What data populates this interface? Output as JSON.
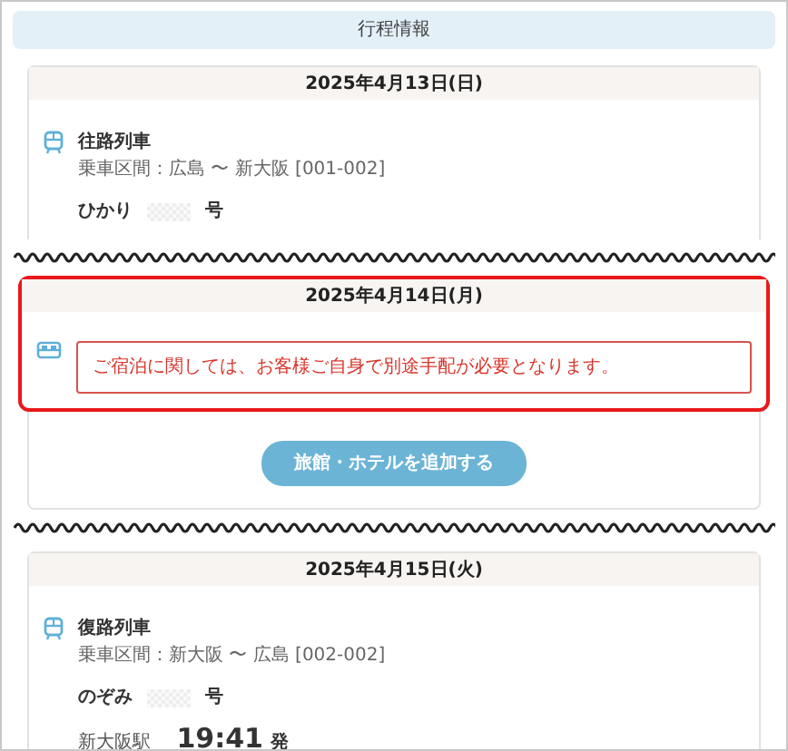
{
  "header": {
    "title": "行程情報"
  },
  "sections": [
    {
      "kind": "train",
      "date": "2025年4月13日(日)",
      "highlighted": false,
      "title": "往路列車",
      "route": "乗車区間：広島 〜 新大阪 [001-002]",
      "train_name": "ひかり",
      "train_suffix": "号"
    },
    {
      "kind": "stay",
      "date": "2025年4月14日(月)",
      "highlighted": true,
      "alert": "ご宿泊に関しては、お客様ご自身で別途手配が必要となります。",
      "button": "旅館・ホテルを追加する"
    },
    {
      "kind": "train",
      "date": "2025年4月15日(火)",
      "highlighted": false,
      "title": "復路列車",
      "route": "乗車区間：新大阪 〜 広島 [002-002]",
      "train_name": "のぞみ",
      "train_suffix": "号",
      "station": "新大阪駅",
      "time": "19:41",
      "time_suffix": "発"
    }
  ]
}
